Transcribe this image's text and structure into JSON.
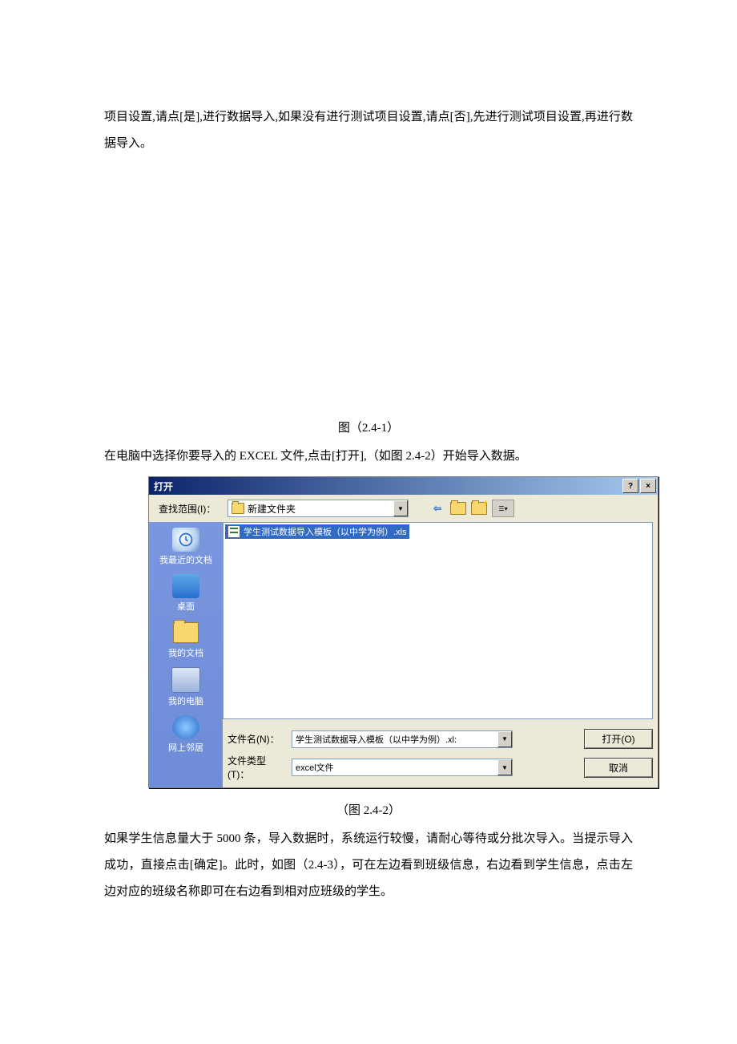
{
  "paragraphs": {
    "p1": "项目设置,请点[是],进行数据导入,如果没有进行测试项目设置,请点[否],先进行测试项目设置,再进行数据导入。",
    "p2": "在电脑中选择你要导入的 EXCEL 文件,点击[打开],（如图 2.4-2）开始导入数据。",
    "p3": "如果学生信息量大于 5000 条，导入数据时，系统运行较慢，请耐心等待或分批次导入。当提示导入成功，直接点击[确定]。此时，如图（2.4-3），可在左边看到班级信息，右边看到学生信息，点击左边对应的班级名称即可在右边看到相对应班级的学生。"
  },
  "captions": {
    "c1": "图（2.4-1）",
    "c2": "（图 2.4-2）"
  },
  "dialog": {
    "title": "打开",
    "help_btn": "?",
    "close_btn": "×",
    "lookin_label": "查找范围(I)：",
    "lookin_value": "新建文件夹",
    "places": {
      "recent": "我最近的文档",
      "desktop": "桌面",
      "mydocs": "我的文档",
      "mycomputer": "我的电脑",
      "network": "网上邻居"
    },
    "file_selected": "学生测试数据导入模板（以中学为例）.xls",
    "filename_label": "文件名(N)：",
    "filename_value": "学生测试数据导入模板（以中学为例）.xl:",
    "filetype_label": "文件类型(T)：",
    "filetype_value": "excel文件",
    "open_btn": "打开(O)",
    "cancel_btn": "取消"
  }
}
